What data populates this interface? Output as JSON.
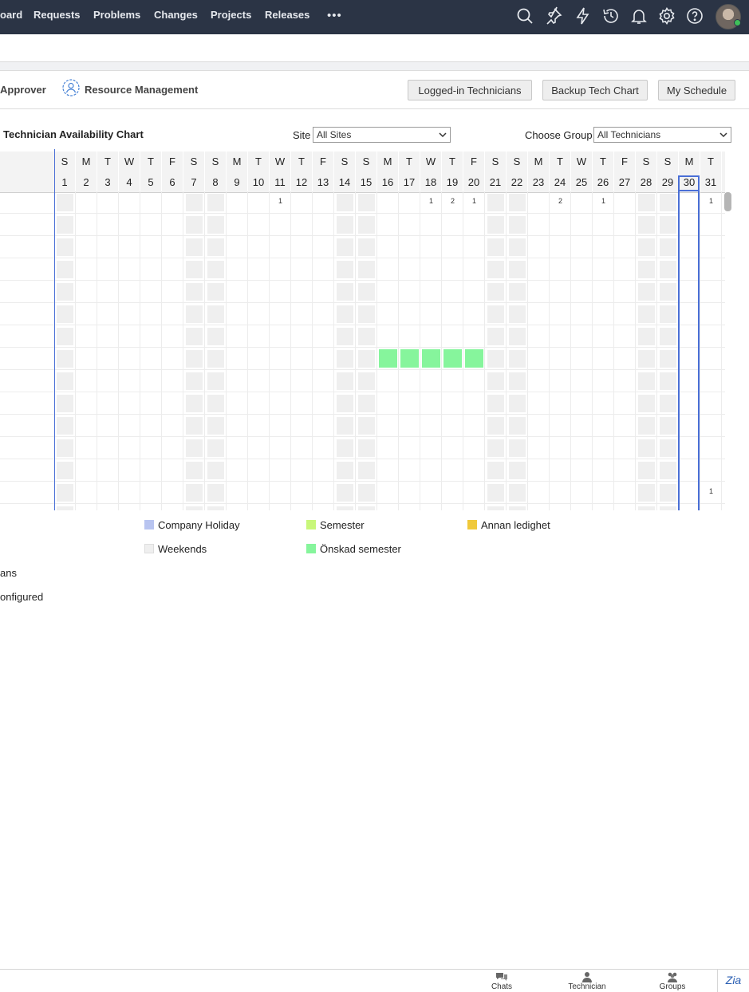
{
  "nav": {
    "items": [
      "oard",
      "Requests",
      "Problems",
      "Changes",
      "Projects",
      "Releases"
    ],
    "more": "•••"
  },
  "top_icons": [
    "search-icon",
    "pin-icon",
    "lightning-icon",
    "history-icon",
    "bell-icon",
    "gear-icon",
    "help-icon"
  ],
  "toolbar": {
    "approver": "Approver",
    "resource_management": "Resource Management",
    "logged_in": "Logged-in Technicians",
    "backup": "Backup Tech Chart",
    "my_schedule": "My Schedule"
  },
  "chart": {
    "title": "Technician Availability Chart",
    "site_label": "Site",
    "site_value": "All Sites",
    "group_label": "Choose Group",
    "group_value": "All Technicians",
    "weekdays": [
      "S",
      "M",
      "T",
      "W",
      "T",
      "F",
      "S",
      "S",
      "M",
      "T",
      "W",
      "T",
      "F",
      "S",
      "S",
      "M",
      "T",
      "W",
      "T",
      "F",
      "S",
      "S",
      "M",
      "T",
      "W",
      "T",
      "F",
      "S",
      "S",
      "M",
      "T"
    ],
    "dates": [
      "1",
      "2",
      "3",
      "4",
      "5",
      "6",
      "7",
      "8",
      "9",
      "10",
      "11",
      "12",
      "13",
      "14",
      "15",
      "16",
      "17",
      "18",
      "19",
      "20",
      "21",
      "22",
      "23",
      "24",
      "25",
      "26",
      "27",
      "28",
      "29",
      "30",
      "31"
    ],
    "weekend_days": [
      1,
      7,
      8,
      14,
      15,
      21,
      22,
      28,
      29
    ],
    "today": 30,
    "row_count": 15,
    "leave_rows": [
      {
        "row": 7,
        "days": [
          16,
          17,
          18,
          19,
          20
        ],
        "type": "Önskad semester"
      }
    ],
    "counts": [
      {
        "row": 0,
        "day": 11,
        "value": "1"
      },
      {
        "row": 0,
        "day": 18,
        "value": "1"
      },
      {
        "row": 0,
        "day": 19,
        "value": "2"
      },
      {
        "row": 0,
        "day": 20,
        "value": "1"
      },
      {
        "row": 0,
        "day": 24,
        "value": "2"
      },
      {
        "row": 0,
        "day": 26,
        "value": "1"
      },
      {
        "row": 0,
        "day": 31,
        "value": "1"
      },
      {
        "row": 13,
        "day": 31,
        "value": "1"
      }
    ]
  },
  "legend": {
    "company_holiday": "Company Holiday",
    "semester": "Semester",
    "annan": "Annan ledighet",
    "weekends": "Weekends",
    "onskad": "Önskad semester",
    "colors": {
      "company_holiday": "#b8c4f0",
      "semester": "#c8f77a",
      "annan": "#f0c93a",
      "weekends": "#efefef",
      "onskad": "#86f59c"
    }
  },
  "side": {
    "line1": "ans",
    "line2": "onfigured"
  },
  "footer": {
    "chats": "Chats",
    "technician": "Technician",
    "groups": "Groups",
    "zia": "Zia"
  }
}
